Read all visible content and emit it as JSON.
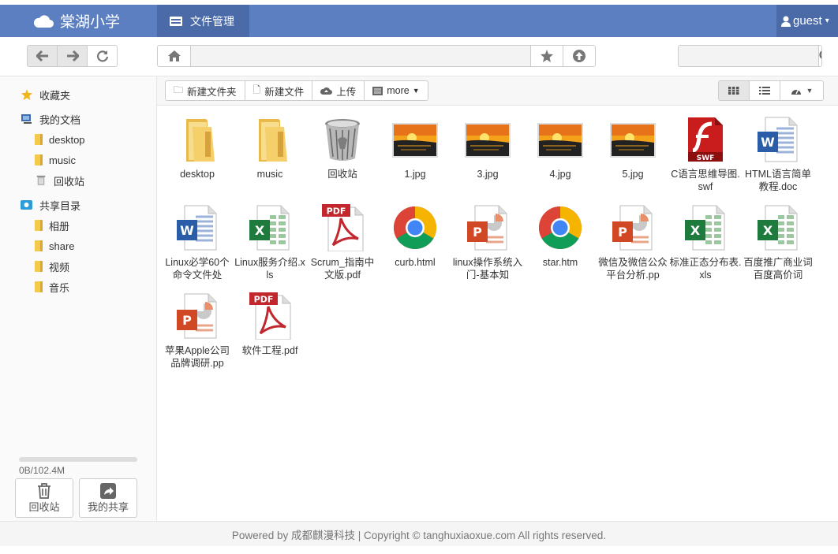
{
  "brand": {
    "name": "棠湖小学"
  },
  "nav": {
    "tab_label": "文件管理"
  },
  "user": {
    "name": "guest"
  },
  "toolbar": {
    "back_icon": "arrow-left-icon",
    "forward_icon": "arrow-right-icon",
    "refresh_icon": "refresh-icon",
    "path": "",
    "search_placeholder": ""
  },
  "sidebar": {
    "favorites": "收藏夹",
    "my_docs": "我的文档",
    "docs": [
      "desktop",
      "music",
      "回收站"
    ],
    "shared": "共享目录",
    "shared_items": [
      "相册",
      "share",
      "视频",
      "音乐"
    ],
    "quota_text": "0B/102.4M",
    "quota_fraction": 0,
    "recycle_label": "回收站",
    "share_label": "我的共享"
  },
  "file_toolbar": {
    "new_folder": "新建文件夹",
    "new_file": "新建文件",
    "upload": "上传",
    "more": "more"
  },
  "files": [
    {
      "name": "desktop",
      "type": "folder"
    },
    {
      "name": "music",
      "type": "folder"
    },
    {
      "name": "回收站",
      "type": "recycle"
    },
    {
      "name": "1.jpg",
      "type": "image"
    },
    {
      "name": "3.jpg",
      "type": "image"
    },
    {
      "name": "4.jpg",
      "type": "image"
    },
    {
      "name": "5.jpg",
      "type": "image"
    },
    {
      "name": "C语言思维导图.swf",
      "type": "swf"
    },
    {
      "name": "HTML语言简单教程.doc",
      "type": "word"
    },
    {
      "name": "Linux必学60个命令文件处",
      "type": "word"
    },
    {
      "name": "Linux服务介绍.xls",
      "type": "excel"
    },
    {
      "name": "Scrum_指南中文版.pdf",
      "type": "pdf"
    },
    {
      "name": "curb.html",
      "type": "chrome"
    },
    {
      "name": "linux操作系统入门-基本知",
      "type": "ppt"
    },
    {
      "name": "star.htm",
      "type": "chrome"
    },
    {
      "name": "微信及微信公众平台分析.pp",
      "type": "ppt"
    },
    {
      "name": "标准正态分布表.xls",
      "type": "excel"
    },
    {
      "name": "百度推广商业词 百度高价词",
      "type": "excel"
    },
    {
      "name": "苹果Apple公司品牌调研.pp",
      "type": "ppt"
    },
    {
      "name": "软件工程.pdf",
      "type": "pdf"
    }
  ],
  "footer": {
    "text": "Powered by 成都麒漫科技 | Copyright © tanghuxiaoxue.com All rights reserved."
  }
}
